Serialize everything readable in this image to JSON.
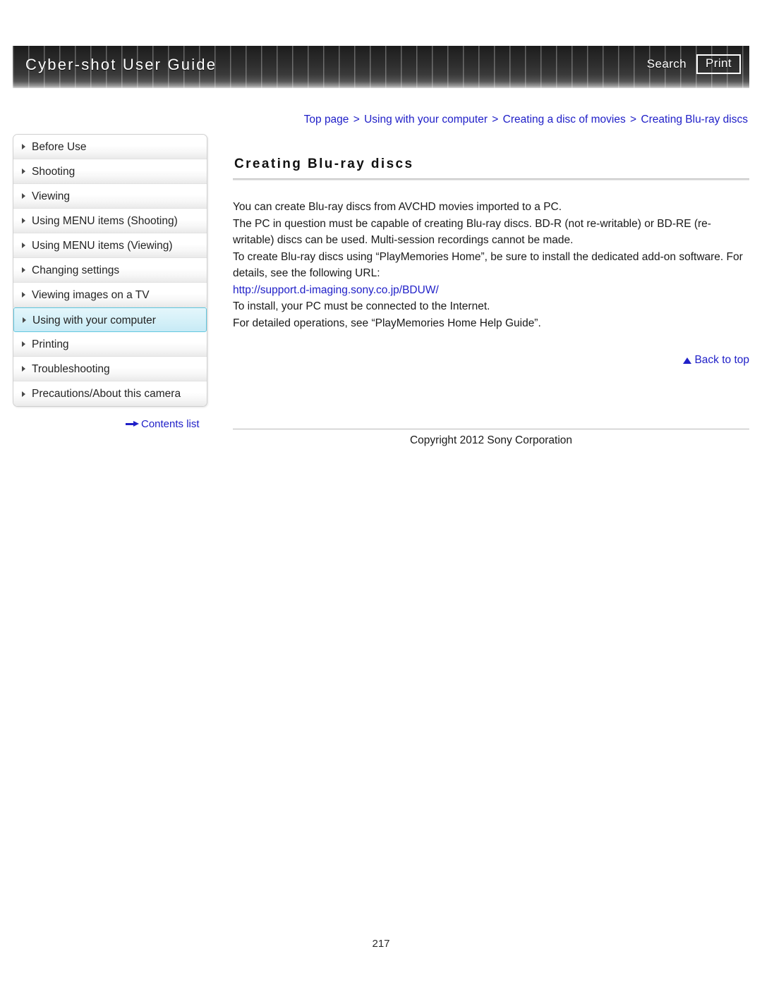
{
  "header": {
    "title": "Cyber-shot User Guide",
    "search_label": "Search",
    "print_label": "Print"
  },
  "breadcrumb": {
    "items": [
      {
        "label": "Top page"
      },
      {
        "label": "Using with your computer"
      },
      {
        "label": "Creating a disc of movies"
      },
      {
        "label": "Creating Blu-ray discs"
      }
    ],
    "separator": ">"
  },
  "sidebar": {
    "items": [
      {
        "label": "Before Use",
        "selected": false
      },
      {
        "label": "Shooting",
        "selected": false
      },
      {
        "label": "Viewing",
        "selected": false
      },
      {
        "label": "Using MENU items (Shooting)",
        "selected": false
      },
      {
        "label": "Using MENU items (Viewing)",
        "selected": false
      },
      {
        "label": "Changing settings",
        "selected": false
      },
      {
        "label": "Viewing images on a TV",
        "selected": false
      },
      {
        "label": "Using with your computer",
        "selected": true
      },
      {
        "label": "Printing",
        "selected": false
      },
      {
        "label": "Troubleshooting",
        "selected": false
      },
      {
        "label": "Precautions/About this camera",
        "selected": false
      }
    ],
    "contents_list_label": "Contents list"
  },
  "main": {
    "title": "Creating Blu-ray discs",
    "paragraph_1": "You can create Blu-ray discs from AVCHD movies imported to a PC.",
    "paragraph_2": "The PC in question must be capable of creating Blu-ray discs. BD-R (not re-writable) or BD-RE (re-writable) discs can be used. Multi-session recordings cannot be made.",
    "paragraph_3": "To create Blu-ray discs using “PlayMemories Home”, be sure to install the dedicated add-on software. For details, see the following URL:",
    "url": "http://support.d-imaging.sony.co.jp/BDUW/",
    "paragraph_4": "To install, your PC must be connected to the Internet.",
    "paragraph_5": "For detailed operations, see “PlayMemories Home Help Guide”.",
    "back_to_top_label": "Back to top"
  },
  "footer": {
    "copyright": "Copyright 2012 Sony Corporation",
    "page_number": "217"
  },
  "colors": {
    "link": "#2020c8",
    "selected_nav_bg": "#d4f1f9",
    "selected_nav_border": "#63c8e0",
    "banner_dark": "#242424"
  }
}
